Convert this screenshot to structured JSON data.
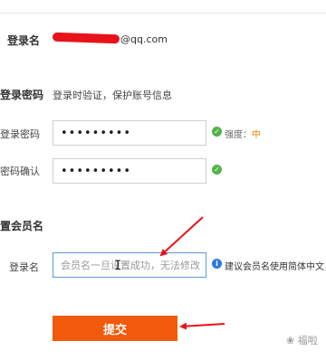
{
  "login": {
    "label": "登录名",
    "email_suffix": "@qq.com"
  },
  "password_section": {
    "title": "登录密码",
    "description": "登录时验证，保护账号信息",
    "password_label": "登录密码",
    "password_value": "•••••••••",
    "confirm_label": "密码确认",
    "confirm_value": "•••••••••",
    "strength_label": "强度：",
    "strength_value": "中"
  },
  "member_section": {
    "title": "置会员名",
    "field_label": "登录名",
    "placeholder": "会员名一旦设置成功，无法修改",
    "hint": "建议会员名使用简体中文，"
  },
  "actions": {
    "submit_label": "提交"
  },
  "watermark": "福啦",
  "colors": {
    "accent": "#f15a0b",
    "valid": "#52b44a",
    "info": "#2e7bd6",
    "annotation": "#e8131a",
    "strength_medium": "#f08300"
  },
  "icons": [
    "check-icon",
    "info-icon",
    "text-cursor-icon",
    "annotation-arrow"
  ]
}
